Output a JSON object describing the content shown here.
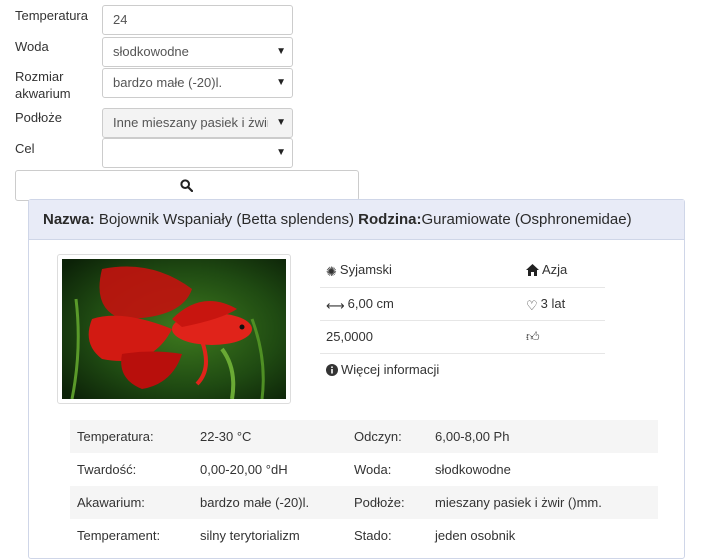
{
  "filters": {
    "temperature": {
      "label": "Temperatura",
      "value": "24"
    },
    "water": {
      "label": "Woda",
      "value": "słodkowodne"
    },
    "size": {
      "label_line1": "Rozmiar",
      "label_line2": "akwarium",
      "value": "bardzo małe (-20)l."
    },
    "substrate": {
      "label": "Podłoże",
      "value": "Inne mieszany pasiek i żwir"
    },
    "goal": {
      "label": "Cel",
      "value": ""
    }
  },
  "result": {
    "name_label": "Nazwa:",
    "name": "Bojownik Wspaniały (Betta splendens)",
    "family_label": "Rodzina:",
    "family": "Guramiowate (Osphronemidae)",
    "origin": "Syjamski",
    "region": "Azja",
    "length": "6,00 cm",
    "lifespan": "3 lat",
    "price": "25,0000",
    "more_info": "Więcej informacji"
  },
  "specs": [
    {
      "k1": "Temperatura:",
      "v1": "22-30 °C",
      "k2": "Odczyn:",
      "v2": "6,00-8,00 Ph"
    },
    {
      "k1": "Twardość:",
      "v1": "0,00-20,00 °dH",
      "k2": "Woda:",
      "v2": "słodkowodne"
    },
    {
      "k1": "Akawarium:",
      "v1": "bardzo małe (-20)l.",
      "k2": "Podłoże:",
      "v2": "mieszany pasiek i żwir ()mm."
    },
    {
      "k1": "Temperament:",
      "v1": "silny terytorializm",
      "k2": "Stado:",
      "v2": "jeden osobnik"
    }
  ]
}
